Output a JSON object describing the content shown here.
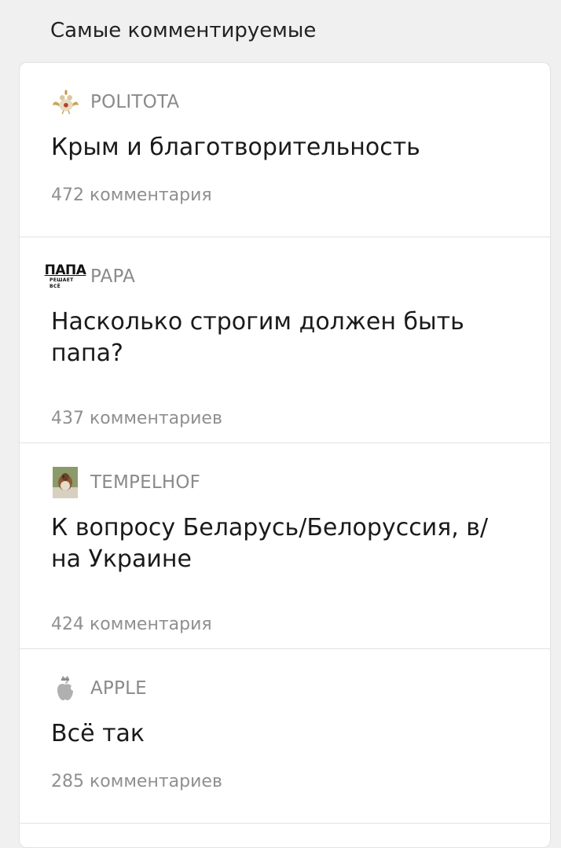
{
  "section": {
    "title": "Самые комментируемые"
  },
  "items": [
    {
      "source": "POLITOTA",
      "icon": "double-headed-bird-icon",
      "title": "Крым и благотворительность",
      "comments": "472 комментария"
    },
    {
      "source": "PAPA",
      "icon": "papa-logo-icon",
      "logo_text": "ПАПА",
      "logo_subtext": "РЕШАЕТ ВСЁ",
      "title": "Насколько строгим должен быть папа?",
      "comments": "437 комментариев"
    },
    {
      "source": "TEMPELHOF",
      "icon": "sparrow-photo-icon",
      "title": "К вопросу Беларусь/Белоруссия, в/на Украине",
      "comments": "424 комментария"
    },
    {
      "source": "APPLE",
      "icon": "apple-crown-icon",
      "title": "Всё так",
      "comments": "285 комментариев"
    }
  ],
  "colors": {
    "background": "#f0f0f0",
    "card": "#ffffff",
    "muted_text": "#8a8a8a",
    "title_text": "#1a1a1a"
  }
}
